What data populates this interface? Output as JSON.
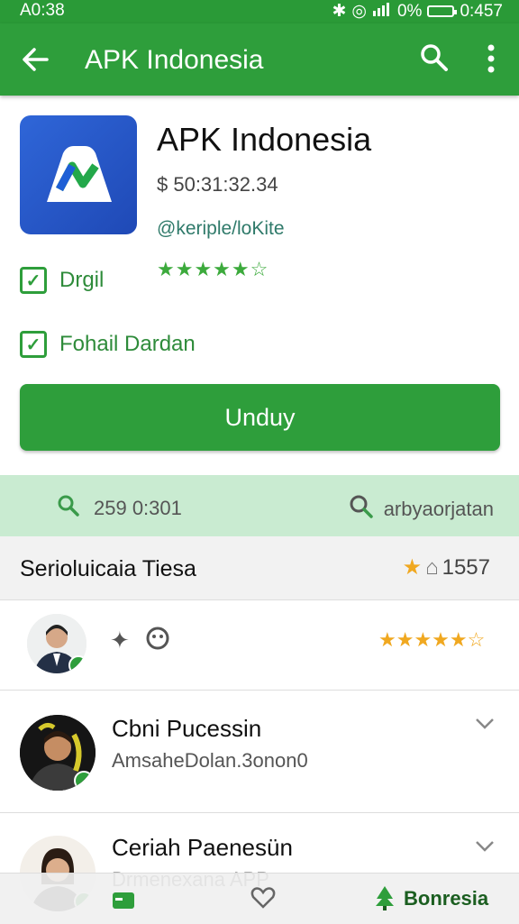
{
  "status_bar": {
    "time": "A0:38",
    "battery_text": "0%",
    "clock_right": "0:457"
  },
  "app_bar": {
    "title": "APK Indonesia"
  },
  "app": {
    "name": "APK Indonesia",
    "price": "$ 50:31:32.34",
    "developer": "@keriple/loKite",
    "rating": 4.5,
    "stars_text": "★★★★★☆"
  },
  "checks": [
    {
      "label": "Drgil",
      "checked": true
    },
    {
      "label": "Fohail Dardan",
      "checked": true
    }
  ],
  "download_label": "Unduy",
  "info": {
    "left_value": "259 0:301",
    "right_value": "arbyaorjatan"
  },
  "reviews_section": {
    "title": "Serioluicaia Tiesa",
    "count": "1557"
  },
  "reviews": [
    {
      "stars_text": "★★★★★☆"
    },
    {
      "name": "Cbni Pucessin",
      "subtitle": "AmsaheDolan.3onon0"
    },
    {
      "name": "Ceriah Paenesün",
      "subtitle": "Drmenexana APP"
    }
  ],
  "bottom_nav": {
    "active_tab": "Bonresia"
  },
  "colors": {
    "primary": "#2e9e3b",
    "status": "#2a9a37",
    "strip": "#c9ebd1",
    "star_gold": "#f0a820"
  }
}
